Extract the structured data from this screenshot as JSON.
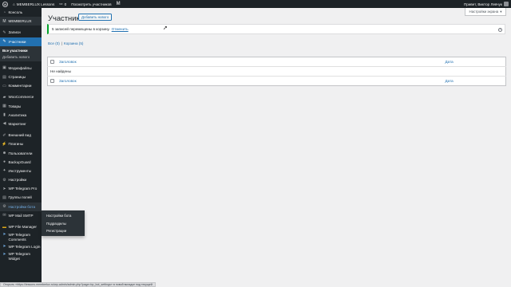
{
  "adminbar": {
    "site_name": "MEMBERLUX Lessons",
    "comments_count": "0",
    "view_label": "Посмотреть участников",
    "greeting": "Привет, Виктор Левчук"
  },
  "sidebar": {
    "items": [
      {
        "label": "Консоль",
        "icon": "dashboard-icon"
      },
      {
        "label": "MEMBERLUX",
        "icon": "memberlux-icon"
      },
      {
        "label": "Записи",
        "icon": "pin-icon"
      },
      {
        "label": "Участники",
        "icon": "pin-icon"
      },
      {
        "label": "Медиафайлы",
        "icon": "media-icon"
      },
      {
        "label": "Страницы",
        "icon": "page-icon"
      },
      {
        "label": "Комментарии",
        "icon": "comment-icon"
      },
      {
        "label": "WooCommerce",
        "icon": "woo-icon"
      },
      {
        "label": "Товары",
        "icon": "products-icon"
      },
      {
        "label": "Аналитика",
        "icon": "analytics-icon"
      },
      {
        "label": "Маркетинг",
        "icon": "marketing-icon"
      },
      {
        "label": "Внешний вид",
        "icon": "brush-icon"
      },
      {
        "label": "Плагины",
        "icon": "plugin-icon"
      },
      {
        "label": "Пользователи",
        "icon": "users-icon"
      },
      {
        "label": "BackupGuard",
        "icon": "backup-icon"
      },
      {
        "label": "Инструменты",
        "icon": "tools-icon"
      },
      {
        "label": "Настройки",
        "icon": "settings-icon"
      },
      {
        "label": "WP Telegram Pro",
        "icon": "telegram-icon"
      },
      {
        "label": "Группы полей",
        "icon": "fields-icon"
      },
      {
        "label": "Настройки бота",
        "icon": "bot-icon"
      },
      {
        "label": "WP Mail SMTP",
        "icon": "mail-icon"
      },
      {
        "label": "WP File Manager",
        "icon": "file-manager-icon"
      },
      {
        "label": "WP Telegram Comments",
        "icon": "telegram-icon"
      },
      {
        "label": "WP Telegram Login",
        "icon": "telegram-icon"
      },
      {
        "label": "WP Telegram Widget",
        "icon": "telegram-icon"
      }
    ],
    "submenu": [
      "Все участники",
      "Добавить нового"
    ]
  },
  "flyout": [
    "Настройки бота",
    "Подразделы",
    "Регистрации"
  ],
  "main": {
    "screen_options": "Настройки экрана",
    "title": "Участники",
    "add_new": "Добавить нового",
    "notice_text": "5 записей перемещены в корзину.",
    "notice_undo": "Отменить",
    "filter_all": "Все (0)",
    "filter_sep": "|",
    "filter_trash": "Корзина (5)",
    "table": {
      "col_title": "Заголовок",
      "col_date": "Дата",
      "empty": "Не найдены"
    }
  },
  "statusbar": "Открыть «https://lessons.memberlux.ru/wp-admin/admin.php?page=bp_bot_settings» в новой вкладке под текущей"
}
